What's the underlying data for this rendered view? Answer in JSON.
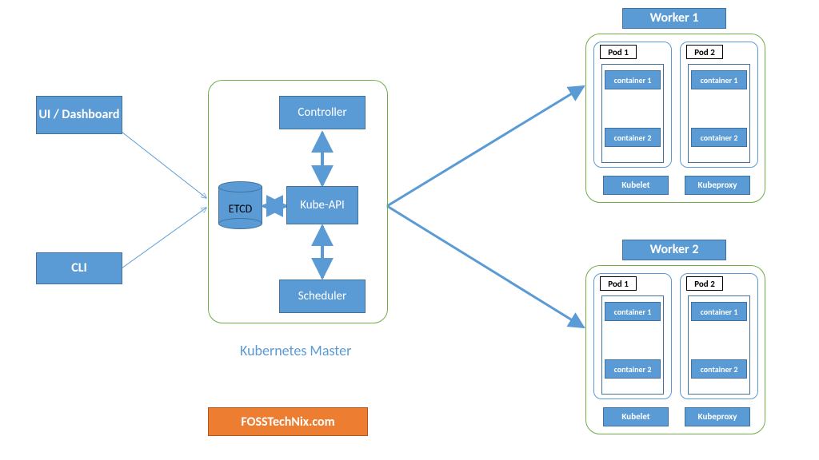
{
  "clients": {
    "ui": "UI / Dashboard",
    "cli": "CLI"
  },
  "master": {
    "caption": "Kubernetes Master",
    "etcd": "ETCD",
    "controller": "Controller",
    "api": "Kube-API",
    "scheduler": "Scheduler"
  },
  "workers": [
    {
      "title": "Worker 1",
      "pods": [
        {
          "label": "Pod 1",
          "containers": [
            "container 1",
            "container 2"
          ]
        },
        {
          "label": "Pod 2",
          "containers": [
            "container 1",
            "container 2"
          ]
        }
      ],
      "services": [
        "Kubelet",
        "Kubeproxy"
      ]
    },
    {
      "title": "Worker 2",
      "pods": [
        {
          "label": "Pod 1",
          "containers": [
            "container 1",
            "container 2"
          ]
        },
        {
          "label": "Pod 2",
          "containers": [
            "container 1",
            "container 2"
          ]
        }
      ],
      "services": [
        "Kubelet",
        "Kubeproxy"
      ]
    }
  ],
  "footer": "FOSSTechNix.com"
}
